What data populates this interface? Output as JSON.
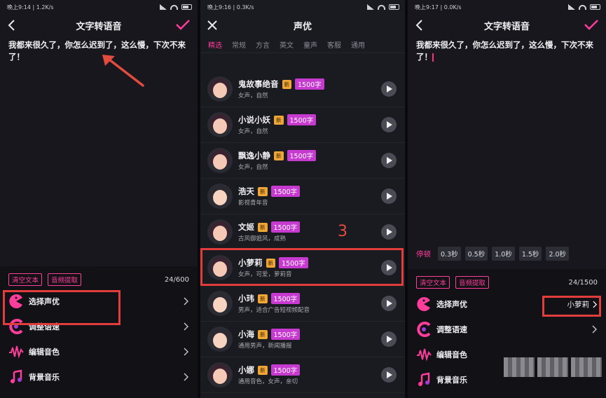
{
  "screens": [
    {
      "status": {
        "time": "晚上9:14 | 1.2K/s"
      },
      "title": "文字转语音",
      "text": "我都来很久了，你怎么迟到了，这么慢，下次不来了！",
      "chips": [
        "清空文本",
        "音频提取"
      ],
      "counter": "24/600",
      "menu": [
        {
          "label": "选择声优",
          "icon": "pacman-icon"
        },
        {
          "label": "调整语速",
          "icon": "speed-icon"
        },
        {
          "label": "编辑音色",
          "icon": "waveform-icon"
        },
        {
          "label": "背景音乐",
          "icon": "music-note-icon"
        }
      ]
    },
    {
      "status": {
        "time": "晚上9:16 | 0.3K/s"
      },
      "title": "声优",
      "tabs": [
        "精选",
        "常规",
        "方言",
        "英文",
        "童声",
        "客服",
        "通用"
      ],
      "step_number": "3",
      "voices": [
        {
          "name": "鬼故事绝音",
          "desc": "女声，自然",
          "badge": "1500字",
          "gender": "female"
        },
        {
          "name": "小说小妖",
          "desc": "女声，自然",
          "badge": "1500字",
          "gender": "female"
        },
        {
          "name": "飘逸小静",
          "desc": "女声，自然",
          "badge": "1500字",
          "gender": "female"
        },
        {
          "name": "浩天",
          "desc": "影视青年音",
          "badge": "1500字",
          "gender": "male"
        },
        {
          "name": "文姬",
          "desc": "古风御姐风，成熟",
          "badge": "1500字",
          "gender": "female"
        },
        {
          "name": "小萝莉",
          "desc": "女声，可爱，萝莉音",
          "badge": "1500字",
          "gender": "female"
        },
        {
          "name": "小玮",
          "desc": "男声，适合广告短视频配音",
          "badge": "1500字",
          "gender": "male"
        },
        {
          "name": "小海",
          "desc": "通用男声，新闻播报",
          "badge": "1500字",
          "gender": "male"
        },
        {
          "name": "小娜",
          "desc": "通用音色，女声，亲切",
          "badge": "1500字",
          "gender": "female"
        }
      ],
      "new_badge": "新"
    },
    {
      "status": {
        "time": "晚上9:17 | 0.0K/s"
      },
      "title": "文字转语音",
      "text": "我都来很久了，你怎么迟到了，这么慢，下次不来了！",
      "pause": {
        "label": "停顿",
        "options": [
          "0.3秒",
          "0.5秒",
          "1.0秒",
          "1.5秒",
          "2.0秒"
        ]
      },
      "chips": [
        "清空文本",
        "音频提取"
      ],
      "counter": "24/1500",
      "selected_voice": "小萝莉",
      "menu": [
        {
          "label": "选择声优",
          "icon": "pacman-icon"
        },
        {
          "label": "调整语速",
          "icon": "speed-icon"
        },
        {
          "label": "编辑音色",
          "icon": "waveform-icon"
        },
        {
          "label": "背景音乐",
          "icon": "music-note-icon"
        }
      ]
    }
  ],
  "colors": {
    "accent": "#ff3d9a",
    "highlight": "#e23d3d",
    "badge": "#c63ad0",
    "new": "#f0a636"
  }
}
